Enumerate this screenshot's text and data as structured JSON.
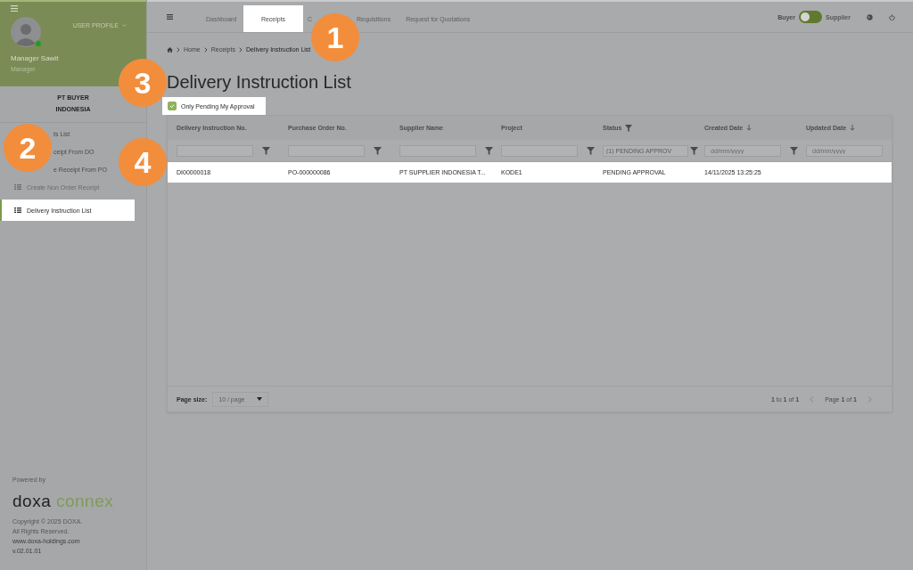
{
  "sidebar": {
    "user_profile_label": "USER PROFILE",
    "user_name": "Manager Sawit",
    "user_role": "Manager",
    "online": true,
    "company": "PT BUYER INDONESIA",
    "items": [
      {
        "label": "ts List",
        "selected": false
      },
      {
        "label": "ceipt From DO",
        "selected": false
      },
      {
        "label": "e Receipt From PO",
        "selected": false
      },
      {
        "label": "Create Non Order Receipt",
        "selected": false
      },
      {
        "label": "Delivery Instruction List",
        "selected": true
      }
    ],
    "footer": {
      "powered_by": "Powered by",
      "logo_left": "doxa",
      "logo_right": "connex",
      "copyright": "Copyright © 2025 DOXA.",
      "rights": "All Rights Reserved.",
      "website": "www.doxa-holdings.com",
      "version": "v.02.01.01"
    }
  },
  "nav": {
    "tabs": [
      {
        "label": "Dashboard",
        "selected": false
      },
      {
        "label": "Receipts",
        "selected": true
      },
      {
        "label": "C",
        "selected": false
      },
      {
        "label": "Requisitions",
        "selected": false
      },
      {
        "label": "Request for Quotations",
        "selected": false
      }
    ],
    "role_toggle": {
      "left": "Buyer",
      "right": "Supplier",
      "on": false
    }
  },
  "breadcrumb": [
    "Home",
    "Receipts",
    "Delivery Instruction List"
  ],
  "title": "Delivery Instruction List",
  "pending_filter": {
    "label": "Only Pending My Approval",
    "checked": true
  },
  "table": {
    "columns": [
      {
        "label": "Delivery Instruction No.",
        "kind": "plain"
      },
      {
        "label": "Purchase Order No.",
        "kind": "plain"
      },
      {
        "label": "Supplier Name",
        "kind": "plain"
      },
      {
        "label": "Project",
        "kind": "plain"
      },
      {
        "label": "Status",
        "kind": "filtered",
        "filter_placeholder": "(1) PENDING APPROV"
      },
      {
        "label": "Created Date",
        "kind": "sorted",
        "filter_placeholder": "dd/mm/yyyy"
      },
      {
        "label": "Updated Date",
        "kind": "sorted",
        "filter_placeholder": "dd/mm/yyyy"
      }
    ],
    "rows": [
      {
        "cells": [
          "DI00000018",
          "PO-000000086",
          "PT SUPPLIER INDONESIA T...",
          "KODE1",
          "PENDING APPROVAL",
          "14/11/2025 13:25:25",
          ""
        ],
        "selected": true
      }
    ]
  },
  "pagination": {
    "page_size_label": "Page size:",
    "page_size": "10 / page",
    "range": "**1** to **1** of **1**",
    "page": "Page **1** of **1**"
  },
  "markers": [
    {
      "number": "1"
    },
    {
      "number": "2"
    },
    {
      "number": "3"
    },
    {
      "number": "4"
    }
  ]
}
